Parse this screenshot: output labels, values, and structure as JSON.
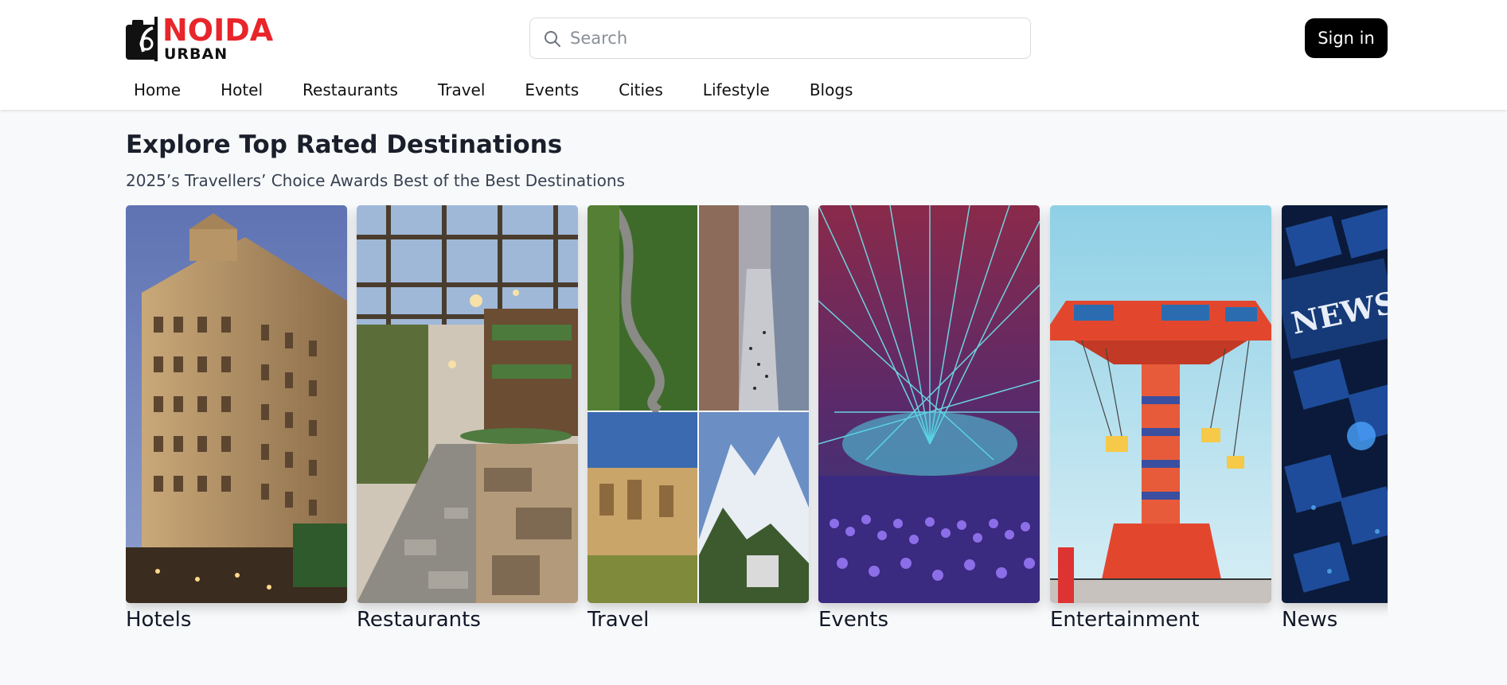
{
  "brand": {
    "name_top": "NOIDA",
    "name_bottom": "URBAN",
    "accent": "#e8252a"
  },
  "search": {
    "placeholder": "Search",
    "icon": "search-icon"
  },
  "header": {
    "signin_label": "Sign in"
  },
  "nav": {
    "items": [
      "Home",
      "Hotel",
      "Restaurants",
      "Travel",
      "Events",
      "Cities",
      "Lifestyle",
      "Blogs"
    ]
  },
  "section": {
    "title": "Explore Top Rated Destinations",
    "subtitle": "2025’s Travellers’ Choice Awards Best of the Best Destinations"
  },
  "cards": [
    {
      "label": "Hotels"
    },
    {
      "label": "Restaurants"
    },
    {
      "label": "Travel"
    },
    {
      "label": "Events"
    },
    {
      "label": "Entertainment"
    },
    {
      "label": "News",
      "image_text": "NEWS"
    }
  ]
}
